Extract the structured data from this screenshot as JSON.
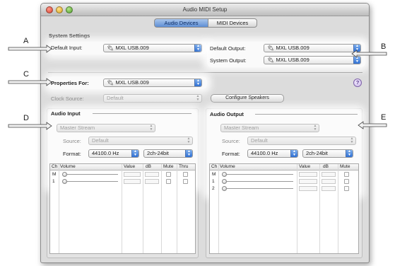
{
  "window": {
    "title": "Audio MIDI Setup",
    "tabs": [
      {
        "label": "Audio Devices",
        "active": true
      },
      {
        "label": "MIDI Devices",
        "active": false
      }
    ]
  },
  "system_settings": {
    "heading": "System Settings",
    "default_input_label": "Default Input:",
    "default_input_value": "MXL USB.009",
    "default_output_label": "Default Output:",
    "default_output_value": "MXL USB.009",
    "system_output_label": "System Output:",
    "system_output_value": "MXL USB.009"
  },
  "properties": {
    "label": "Properties For:",
    "value": "MXL USB.009",
    "help_glyph": "?",
    "clock_source_label": "Clock Source:",
    "clock_source_value": "Default",
    "configure_speakers": "Configure Speakers"
  },
  "audio_input": {
    "heading": "Audio Input",
    "stream": "Master Stream",
    "source_label": "Source:",
    "source_value": "Default",
    "format_label": "Format:",
    "rate": "44100.0 Hz",
    "bits": "2ch-24bit",
    "columns": [
      "Ch",
      "Volume",
      "Value",
      "dB",
      "Mute",
      "Thru"
    ],
    "rows": [
      {
        "ch": "M"
      },
      {
        "ch": "1"
      }
    ]
  },
  "audio_output": {
    "heading": "Audio Output",
    "stream": "Master Stream",
    "source_label": "Source:",
    "source_value": "Default",
    "format_label": "Format:",
    "rate": "44100.0 Hz",
    "bits": "2ch-24bit",
    "columns": [
      "Ch",
      "Volume",
      "Value",
      "dB",
      "Mute"
    ],
    "rows": [
      {
        "ch": "M"
      },
      {
        "ch": "1"
      },
      {
        "ch": "2"
      }
    ]
  },
  "callouts": {
    "a": "A",
    "b": "B",
    "c": "C",
    "d": "D",
    "e": "E"
  },
  "icons": {
    "usb": "usb-icon",
    "stepper": "popup-stepper-icon",
    "help": "help-icon"
  },
  "colors": {
    "accent_blue": "#2f6fd2",
    "window_bg": "#dcdcdc",
    "help_purple": "#7e62a8"
  }
}
